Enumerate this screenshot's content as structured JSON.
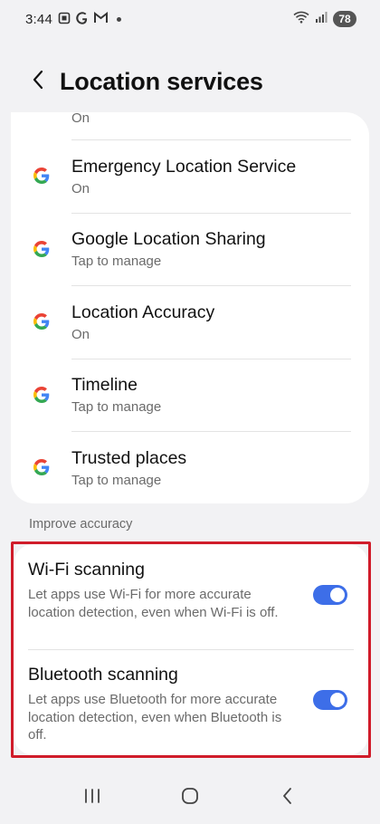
{
  "status": {
    "time": "3:44",
    "icons": [
      "screenshot-icon",
      "google-icon",
      "gmail-icon",
      "notification-dot-icon"
    ],
    "right_icons": [
      "wifi-icon",
      "signal-icon"
    ],
    "battery": "78"
  },
  "header": {
    "back_icon": "chevron-left-icon",
    "title": "Location services"
  },
  "list": {
    "partial_item": {
      "subtitle": "On"
    },
    "items": [
      {
        "icon": "google-g-icon",
        "title": "Emergency Location Service",
        "subtitle": "On"
      },
      {
        "icon": "google-g-icon",
        "title": "Google Location Sharing",
        "subtitle": "Tap to manage"
      },
      {
        "icon": "google-g-icon",
        "title": "Location Accuracy",
        "subtitle": "On"
      },
      {
        "icon": "google-g-icon",
        "title": "Timeline",
        "subtitle": "Tap to manage"
      },
      {
        "icon": "google-g-icon",
        "title": "Trusted places",
        "subtitle": "Tap to manage"
      }
    ]
  },
  "improve": {
    "header": "Improve accuracy",
    "items": [
      {
        "title": "Wi-Fi scanning",
        "description": "Let apps use Wi-Fi for more accurate location detection, even when Wi-Fi is off.",
        "enabled": true
      },
      {
        "title": "Bluetooth scanning",
        "description": "Let apps use Bluetooth for more accurate location detection, even when Bluetooth is off.",
        "enabled": true
      }
    ]
  },
  "nav": {
    "items": [
      "recents-icon",
      "home-icon",
      "back-icon"
    ]
  },
  "colors": {
    "accent": "#3d6ee8",
    "highlight": "#d01c2a",
    "background": "#f2f2f4",
    "card": "#ffffff"
  }
}
